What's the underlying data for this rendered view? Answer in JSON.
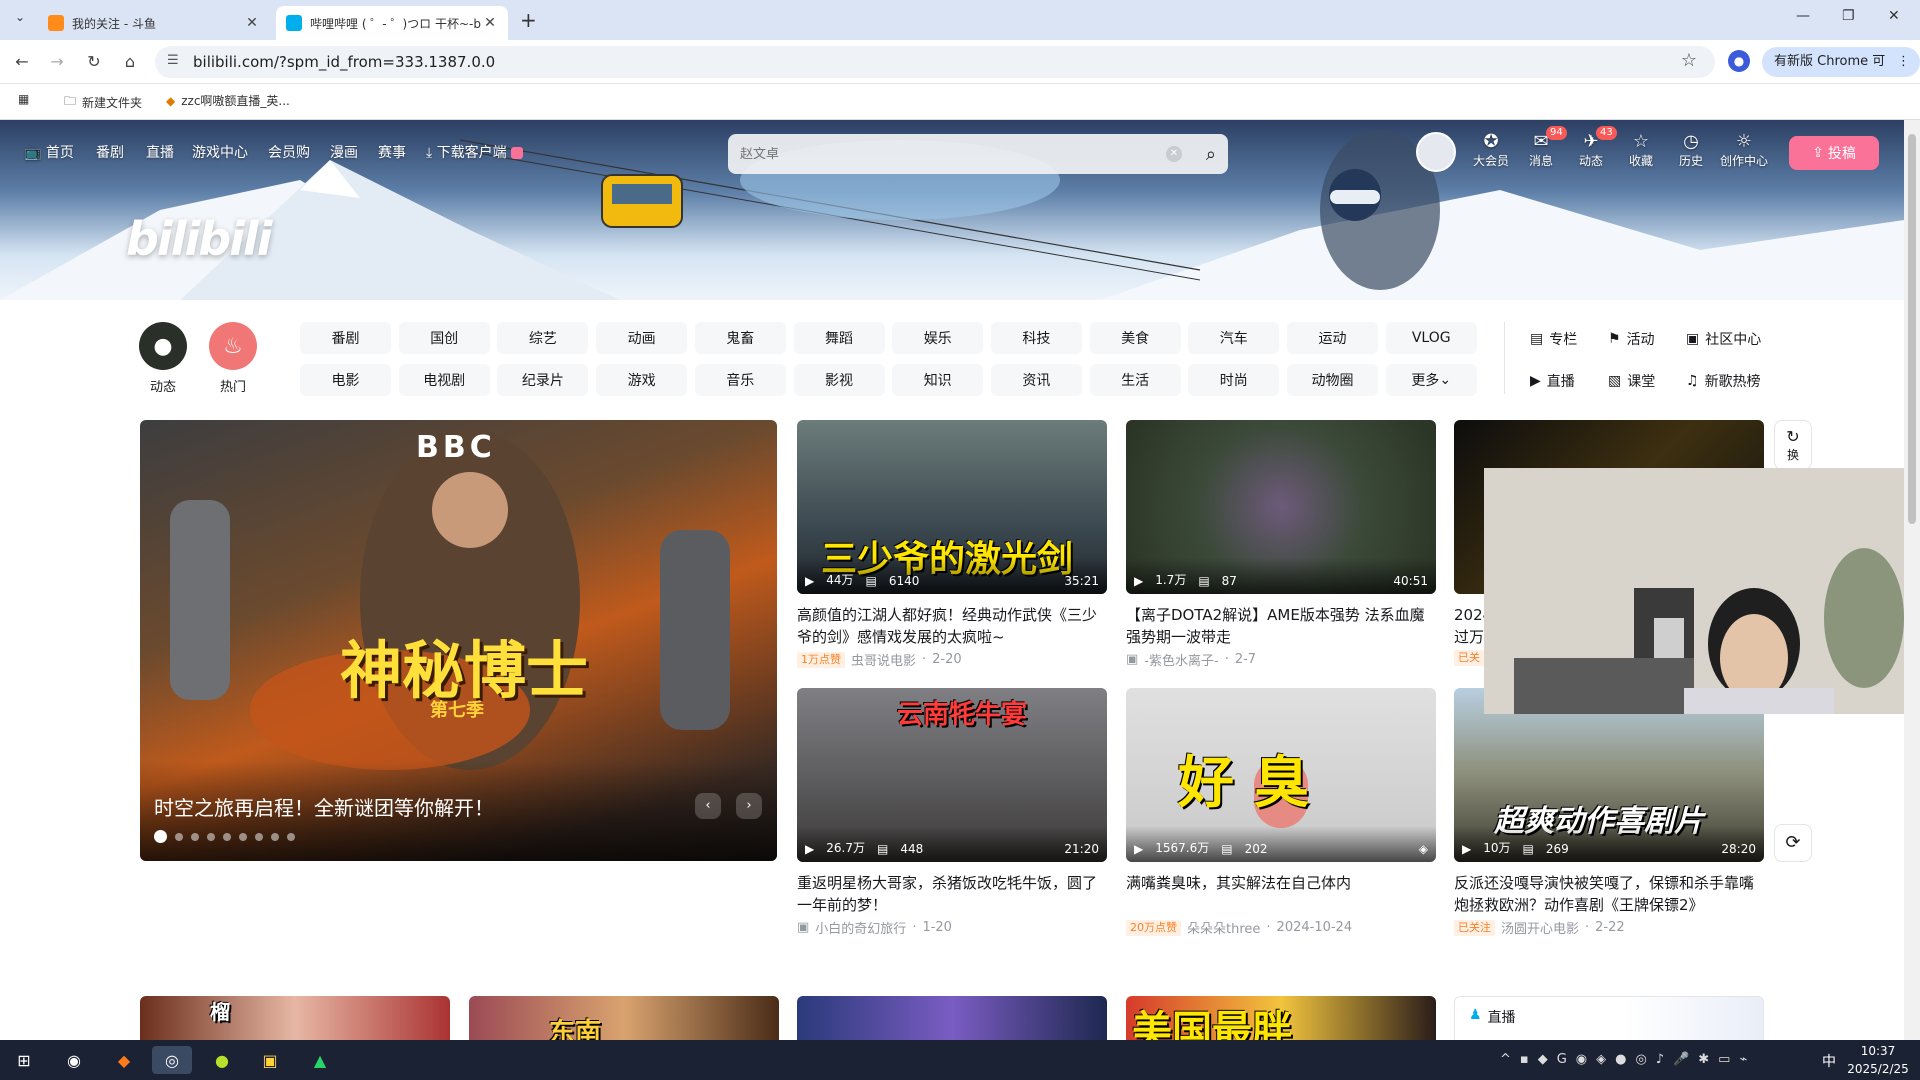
{
  "browser": {
    "tabs": [
      {
        "title": "我的关注 - 斗鱼",
        "active": false
      },
      {
        "title": "哔哩哔哩 ( ゜- ゜)つロ 干杯~-bi",
        "active": true
      }
    ],
    "url": "bilibili.com/?spm_id_from=333.1387.0.0",
    "chrome_update": "有新版 Chrome 可用",
    "bookmarks": [
      "新建文件夹",
      "zzc啊嗷额直播_英..."
    ]
  },
  "header": {
    "nav": [
      "首页",
      "番剧",
      "直播",
      "游戏中心",
      "会员购",
      "漫画",
      "赛事",
      "下载客户端"
    ],
    "search_placeholder": "赵文卓",
    "logo": "bilibili",
    "right": [
      {
        "label": "大会员",
        "icon": "vip-icon",
        "badge": ""
      },
      {
        "label": "消息",
        "icon": "message-icon",
        "badge": "94"
      },
      {
        "label": "动态",
        "icon": "dynamic-icon",
        "badge": "43"
      },
      {
        "label": "收藏",
        "icon": "star-icon",
        "badge": ""
      },
      {
        "label": "历史",
        "icon": "clock-icon",
        "badge": ""
      },
      {
        "label": "创作中心",
        "icon": "bulb-icon",
        "badge": ""
      }
    ],
    "upload": "投稿"
  },
  "channels": {
    "big": [
      {
        "label": "动态"
      },
      {
        "label": "热门"
      }
    ],
    "row1": [
      "番剧",
      "国创",
      "综艺",
      "动画",
      "鬼畜",
      "舞蹈",
      "娱乐",
      "科技",
      "美食",
      "汽车",
      "运动",
      "VLOG"
    ],
    "row2": [
      "电影",
      "电视剧",
      "纪录片",
      "游戏",
      "音乐",
      "影视",
      "知识",
      "资讯",
      "生活",
      "时尚",
      "动物圈",
      "更多"
    ],
    "side": [
      "专栏",
      "活动",
      "社区中心",
      "直播",
      "课堂",
      "新歌热榜"
    ]
  },
  "carousel": {
    "caption": "时空之旅再启程！全新谜团等你解开！",
    "overlay_title": "神秘博士",
    "overlay_sub": "第七季",
    "overlay_logo": "BBC"
  },
  "refresh_label": "换",
  "videos": [
    {
      "views": "44万",
      "danmaku": "6140",
      "duration": "35:21",
      "title": "高颜值的江湖人都好疯！经典动作武侠《三少爷的剑》感情戏发展的太疯啦~",
      "tag": "1万点赞",
      "author": "虫哥说电影",
      "date": "2-20",
      "overlay": "三少爷的激光剑"
    },
    {
      "views": "1.7万",
      "danmaku": "87",
      "duration": "40:51",
      "title": "【离子DOTA2解说】AME版本强势 法系血魔 强势期一波带走",
      "tag": "",
      "author": "-紫色水离子-",
      "date": "2-7",
      "overlay": ""
    },
    {
      "views": "26.7万",
      "danmaku": "448",
      "duration": "21:20",
      "title": "重返明星杨大哥家，杀猪饭改吃牦牛饭，圆了一年前的梦！",
      "tag": "",
      "author": "小白的奇幻旅行",
      "date": "1-20",
      "overlay": "云南牦牛宴"
    },
    {
      "views": "1567.6万",
      "danmaku": "202",
      "duration": "",
      "title": "满嘴粪臭味，其实解法在自己体内",
      "tag": "20万点赞",
      "author": "朵朵朵three",
      "date": "2024-10-24",
      "overlay": "好 臭"
    },
    {
      "views": "10万",
      "danmaku": "269",
      "duration": "28:20",
      "title": "反派还没嘎导演快被笑嘎了，保镖和杀手靠嘴炮拯救欧洲？动作喜剧《王牌保镖2》",
      "tag": "已关注",
      "author": "汤圆开心电影",
      "date": "2-22",
      "overlay": "超爽动作喜剧片"
    }
  ],
  "partial": {
    "title_start": "2024",
    "title_next": "过万",
    "tag": "已关"
  },
  "live_label": "直播",
  "bottom_overlays": [
    "榴",
    "东南",
    "美国最胖"
  ],
  "taskbar": {
    "time": "10:37",
    "date": "2025/2/25",
    "ime": "中"
  }
}
